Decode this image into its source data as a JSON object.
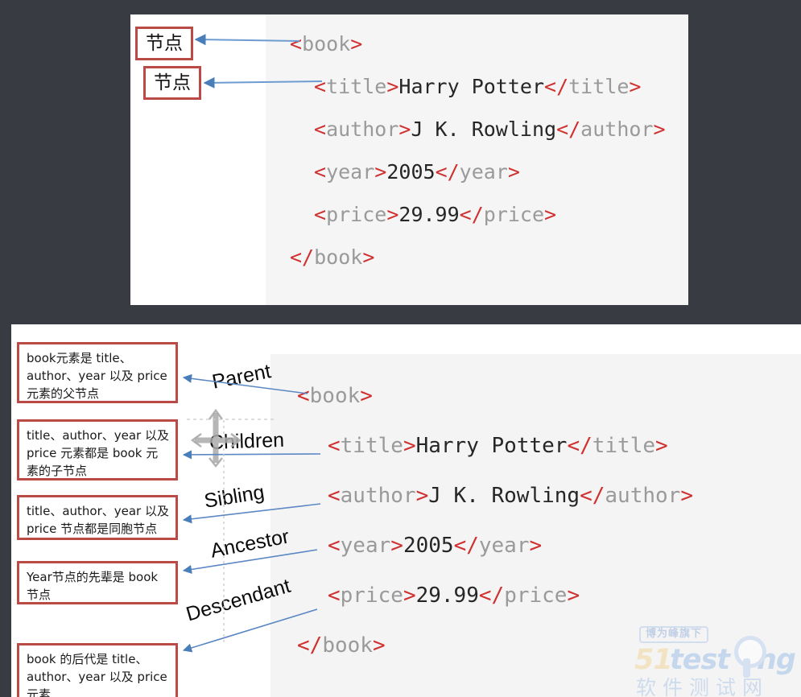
{
  "colors": {
    "page_background": "#383c42",
    "panel_background": "#ffffff",
    "code_panel_background": "#f5f5f5",
    "tag_bracket": "#cf3030",
    "tag_name": "#9a9a9a",
    "text_value": "#262626",
    "box_border": "#b94a45",
    "arrow": "#4a7ebb",
    "watermark_blue": "#9fc0e8",
    "watermark_gold": "#f2d79b"
  },
  "top_panel": {
    "callouts": [
      {
        "label": "节点",
        "target": "book-open-tag"
      },
      {
        "label": "节点",
        "target": "title-line"
      }
    ],
    "code": {
      "lines": [
        {
          "id": "book-open",
          "indent": 0,
          "segments": [
            {
              "t": "tk",
              "v": "<"
            },
            {
              "t": "tn",
              "v": "book"
            },
            {
              "t": "tk",
              "v": ">"
            }
          ]
        },
        {
          "id": "title",
          "indent": 1,
          "segments": [
            {
              "t": "tk",
              "v": "<"
            },
            {
              "t": "tn",
              "v": "title"
            },
            {
              "t": "tk",
              "v": ">"
            },
            {
              "t": "tv",
              "v": "Harry Potter"
            },
            {
              "t": "tk",
              "v": "</"
            },
            {
              "t": "tn",
              "v": "title"
            },
            {
              "t": "tk",
              "v": ">"
            }
          ]
        },
        {
          "id": "author",
          "indent": 1,
          "segments": [
            {
              "t": "tk",
              "v": "<"
            },
            {
              "t": "tn",
              "v": "author"
            },
            {
              "t": "tk",
              "v": ">"
            },
            {
              "t": "tv",
              "v": "J K. Rowling"
            },
            {
              "t": "tk",
              "v": "</"
            },
            {
              "t": "tn",
              "v": "author"
            },
            {
              "t": "tk",
              "v": ">"
            }
          ]
        },
        {
          "id": "year",
          "indent": 1,
          "segments": [
            {
              "t": "tk",
              "v": "<"
            },
            {
              "t": "tn",
              "v": "year"
            },
            {
              "t": "tk",
              "v": ">"
            },
            {
              "t": "tv",
              "v": "2005"
            },
            {
              "t": "tk",
              "v": "</"
            },
            {
              "t": "tn",
              "v": "year"
            },
            {
              "t": "tk",
              "v": ">"
            }
          ]
        },
        {
          "id": "price",
          "indent": 1,
          "segments": [
            {
              "t": "tk",
              "v": "<"
            },
            {
              "t": "tn",
              "v": "price"
            },
            {
              "t": "tk",
              "v": ">"
            },
            {
              "t": "tv",
              "v": "29.99"
            },
            {
              "t": "tk",
              "v": "</"
            },
            {
              "t": "tn",
              "v": "price"
            },
            {
              "t": "tk",
              "v": ">"
            }
          ]
        },
        {
          "id": "book-close",
          "indent": 0,
          "segments": [
            {
              "t": "tk",
              "v": "</"
            },
            {
              "t": "tn",
              "v": "book"
            },
            {
              "t": "tk",
              "v": ">"
            }
          ]
        }
      ]
    }
  },
  "bottom_panel": {
    "notes": [
      {
        "id": "parent",
        "text": "book元素是 title、author、year 以及 price 元素的父节点"
      },
      {
        "id": "children",
        "text": "title、author、year 以及 price 元素都是 book 元素的子节点"
      },
      {
        "id": "sibling",
        "text": "title、author、year 以及 price 节点都是同胞节点"
      },
      {
        "id": "ancestor",
        "text": "Year节点的先辈是 book 节点"
      },
      {
        "id": "descendant",
        "text": "book 的后代是 title、author、year 以及 price 元素"
      }
    ],
    "relation_labels": [
      {
        "id": "parent",
        "text": "Parent"
      },
      {
        "id": "children",
        "text": "Children"
      },
      {
        "id": "sibling",
        "text": "Sibling"
      },
      {
        "id": "ancestor",
        "text": "Ancestor"
      },
      {
        "id": "descendant",
        "text": "Descendant"
      }
    ],
    "code": {
      "lines": [
        {
          "id": "book-open",
          "indent": 0,
          "segments": [
            {
              "t": "tk",
              "v": "<"
            },
            {
              "t": "tn",
              "v": "book"
            },
            {
              "t": "tk",
              "v": ">"
            }
          ]
        },
        {
          "id": "title",
          "indent": 1,
          "segments": [
            {
              "t": "tk",
              "v": "<"
            },
            {
              "t": "tn",
              "v": "title"
            },
            {
              "t": "tk",
              "v": ">"
            },
            {
              "t": "tv",
              "v": "Harry Potter"
            },
            {
              "t": "tk",
              "v": "</"
            },
            {
              "t": "tn",
              "v": "title"
            },
            {
              "t": "tk",
              "v": ">"
            }
          ]
        },
        {
          "id": "author",
          "indent": 1,
          "segments": [
            {
              "t": "tk",
              "v": "<"
            },
            {
              "t": "tn",
              "v": "author"
            },
            {
              "t": "tk",
              "v": ">"
            },
            {
              "t": "tv",
              "v": "J K. Rowling"
            },
            {
              "t": "tk",
              "v": "</"
            },
            {
              "t": "tn",
              "v": "author"
            },
            {
              "t": "tk",
              "v": ">"
            }
          ]
        },
        {
          "id": "year",
          "indent": 1,
          "segments": [
            {
              "t": "tk",
              "v": "<"
            },
            {
              "t": "tn",
              "v": "year"
            },
            {
              "t": "tk",
              "v": ">"
            },
            {
              "t": "tv",
              "v": "2005"
            },
            {
              "t": "tk",
              "v": "</"
            },
            {
              "t": "tn",
              "v": "year"
            },
            {
              "t": "tk",
              "v": ">"
            }
          ]
        },
        {
          "id": "price",
          "indent": 1,
          "segments": [
            {
              "t": "tk",
              "v": "<"
            },
            {
              "t": "tn",
              "v": "price"
            },
            {
              "t": "tk",
              "v": ">"
            },
            {
              "t": "tv",
              "v": "29.99"
            },
            {
              "t": "tk",
              "v": "</"
            },
            {
              "t": "tn",
              "v": "price"
            },
            {
              "t": "tk",
              "v": ">"
            }
          ]
        },
        {
          "id": "book-close",
          "indent": 0,
          "segments": [
            {
              "t": "tk",
              "v": "</"
            },
            {
              "t": "tn",
              "v": "book"
            },
            {
              "t": "tk",
              "v": ">"
            }
          ]
        }
      ]
    }
  },
  "watermark": {
    "badge": "博为峰旗下",
    "brand_number": "51",
    "brand_word": "test",
    "brand_tail": "ng",
    "subtitle": "软件测试网"
  }
}
